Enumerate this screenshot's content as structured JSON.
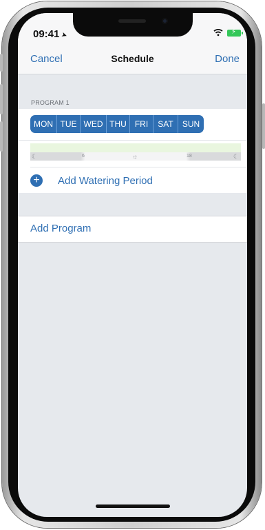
{
  "status_bar": {
    "time": "09:41"
  },
  "nav": {
    "cancel_label": "Cancel",
    "title": "Schedule",
    "done_label": "Done"
  },
  "program": {
    "header": "PROGRAM 1",
    "days": [
      "MON",
      "TUE",
      "WED",
      "THU",
      "FRI",
      "SAT",
      "SUN"
    ],
    "timeline_ticks": [
      "6",
      "18"
    ],
    "add_period_label": "Add Watering Period"
  },
  "add_program_label": "Add Program",
  "colors": {
    "accent": "#2f6fb3",
    "background": "#e6e9ed",
    "timeline_fill": "#e9f6df",
    "battery": "#34c759"
  },
  "icons": {
    "location": "location-arrow-icon",
    "wifi": "wifi-icon",
    "battery": "battery-charging-icon",
    "moon": "moon-icon",
    "sun": "sun-icon",
    "plus": "plus-circle-icon"
  }
}
